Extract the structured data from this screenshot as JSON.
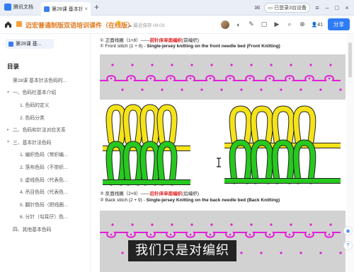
{
  "browser": {
    "app_name": "腾讯文档",
    "tab_label": "第28课 基本针法...",
    "device_status": "已登录3台设备",
    "new_tab_glyph": "+",
    "close_glyph": "×"
  },
  "toolbar": {
    "doc_title": "迈宏普通制版双语培训课件（在线版）",
    "save_status": "最近保存 09:03",
    "collab_count": "41",
    "share_label": "分享"
  },
  "sidebar": {
    "chip_label": "第28课 基...",
    "heading": "目录",
    "items": [
      {
        "label": "第28课 基本针法色码的...",
        "level": 1,
        "caret": ""
      },
      {
        "label": "一、色码栏基本介绍",
        "level": 0,
        "caret": "▾"
      },
      {
        "label": "1. 色码的定义",
        "level": 2,
        "caret": ""
      },
      {
        "label": "2. 色码分类",
        "level": 2,
        "caret": ""
      },
      {
        "label": "二、色码和针法对应关系",
        "level": 0,
        "caret": "▸"
      },
      {
        "label": "三、基本针法色码",
        "level": 0,
        "caret": "▾"
      },
      {
        "label": "1. 编织色码（常织编...",
        "level": 2,
        "caret": ""
      },
      {
        "label": "2. 落布色码（不带织...",
        "level": 2,
        "caret": ""
      },
      {
        "label": "3. 虚线色码（代表色...",
        "level": 2,
        "caret": ""
      },
      {
        "label": "4. 吊目色码（代表色...",
        "level": 2,
        "caret": ""
      },
      {
        "label": "5. 翻针色码（把线圈...",
        "level": 2,
        "caret": ""
      },
      {
        "label": "6. 分针（勾耳仔）色...",
        "level": 2,
        "caret": ""
      },
      {
        "label": "四、其他基本色码",
        "level": 1,
        "caret": ""
      }
    ]
  },
  "document": {
    "line1_prefix": "① 正面线圈（1+8）——",
    "line1_red": "前针床单面编织",
    "line1_suffix": "(前编织)",
    "line2_prefix": "① Front stitch (1 + 8) - ",
    "line2_bold": "Single-jersey knitting on the front needle bed (Front Knitting)",
    "line3_prefix": "② 反面线圈（2+9）——",
    "line3_red": "后针床单面编织",
    "line3_suffix": "(后编织)",
    "line4_prefix": "② Back stitch (2 + 9) - ",
    "line4_bold": "Single-jersey Knitting on the back needle bed (Back Knitting)"
  },
  "colors": {
    "accent": "#2e7cf6",
    "title_orange": "#e07a1f",
    "stitch_yellow": "#f5e31a",
    "stitch_green": "#27c91e",
    "stitch_magenta": "#e21fd9",
    "panel_gray": "#d2d2d2"
  },
  "subtitle": "我们只是对编织"
}
